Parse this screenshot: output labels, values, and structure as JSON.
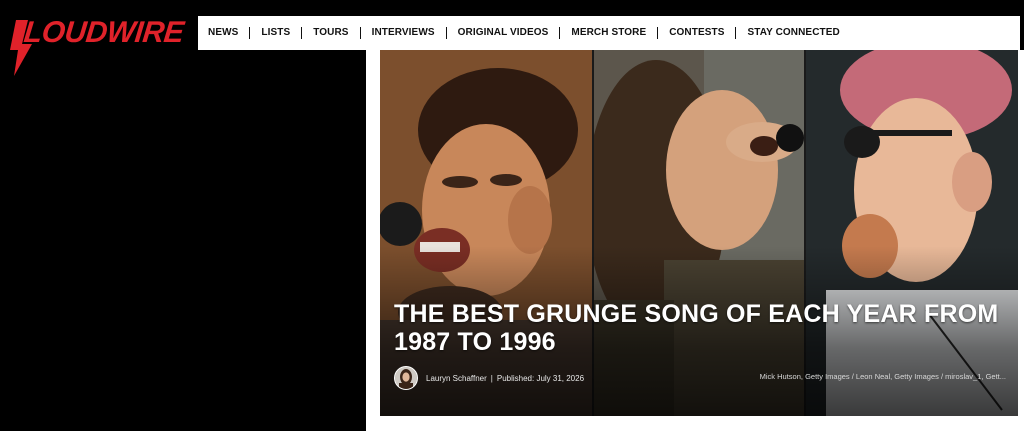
{
  "brand": {
    "name": "LOUDWIRE",
    "color": "#e0222a"
  },
  "nav": {
    "items": [
      {
        "label": "NEWS"
      },
      {
        "label": "LISTS"
      },
      {
        "label": "TOURS"
      },
      {
        "label": "INTERVIEWS"
      },
      {
        "label": "ORIGINAL VIDEOS"
      },
      {
        "label": "MERCH STORE"
      },
      {
        "label": "CONTESTS"
      },
      {
        "label": "STAY CONNECTED"
      }
    ]
  },
  "article": {
    "title": "THE BEST GRUNGE SONG OF EACH YEAR FROM 1987 TO 1996",
    "author": "Lauryn Schaffner",
    "separator": "|",
    "published": "Published: July 31, 2026",
    "photo_credits": "Mick Hutson, Getty Images / Leon Neal, Getty Images / miroslav_1, Gett..."
  }
}
